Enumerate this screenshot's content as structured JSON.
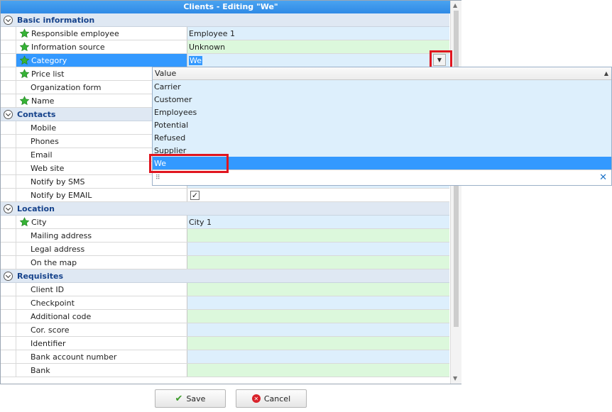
{
  "window": {
    "title": "Clients - Editing \"We\""
  },
  "sections": [
    {
      "title": "Basic information",
      "rows": [
        {
          "label": "Responsible employee",
          "value": "Employee 1",
          "required": true,
          "tone": "blue"
        },
        {
          "label": "Information source",
          "value": "Unknown",
          "required": true,
          "tone": "green"
        },
        {
          "label": "Category",
          "value": "We",
          "required": true,
          "tone": "blue",
          "selected": true
        },
        {
          "label": "Price list",
          "value": "",
          "required": true,
          "tone": "green"
        },
        {
          "label": "Organization form",
          "value": "",
          "required": false,
          "tone": "blue"
        },
        {
          "label": "Name",
          "value": "",
          "required": true,
          "tone": "green"
        }
      ]
    },
    {
      "title": "Contacts",
      "rows": [
        {
          "label": "Mobile",
          "value": "",
          "required": false,
          "tone": "blue"
        },
        {
          "label": "Phones",
          "value": "",
          "required": false,
          "tone": "green"
        },
        {
          "label": "Email",
          "value": "",
          "required": false,
          "tone": "blue"
        },
        {
          "label": "Web site",
          "value": "",
          "required": false,
          "tone": "green"
        },
        {
          "label": "Notify by SMS",
          "value": "",
          "required": false,
          "tone": "blue"
        },
        {
          "label": "Notify by EMAIL",
          "value": "",
          "required": false,
          "tone": "none",
          "checkbox": true,
          "checked": true
        }
      ]
    },
    {
      "title": "Location",
      "rows": [
        {
          "label": "City",
          "value": "City 1",
          "required": true,
          "tone": "blue"
        },
        {
          "label": "Mailing address",
          "value": "",
          "required": false,
          "tone": "green"
        },
        {
          "label": "Legal address",
          "value": "",
          "required": false,
          "tone": "blue"
        },
        {
          "label": "On the map",
          "value": "",
          "required": false,
          "tone": "green"
        }
      ]
    },
    {
      "title": "Requisites",
      "rows": [
        {
          "label": "Client ID",
          "value": "",
          "required": false,
          "tone": "green"
        },
        {
          "label": "Checkpoint",
          "value": "",
          "required": false,
          "tone": "blue"
        },
        {
          "label": "Additional code",
          "value": "",
          "required": false,
          "tone": "green"
        },
        {
          "label": "Cor. score",
          "value": "",
          "required": false,
          "tone": "blue"
        },
        {
          "label": "Identifier",
          "value": "",
          "required": false,
          "tone": "green"
        },
        {
          "label": "Bank account number",
          "value": "",
          "required": false,
          "tone": "blue"
        },
        {
          "label": "Bank",
          "value": "",
          "required": false,
          "tone": "green"
        }
      ]
    }
  ],
  "dropdown": {
    "header": "Value",
    "items": [
      "Carrier",
      "Customer",
      "Employees",
      "Potential",
      "Refused",
      "Supplier",
      "We"
    ],
    "selected": "We"
  },
  "buttons": {
    "save": "Save",
    "cancel": "Cancel"
  },
  "colors": {
    "accent": "#3399ff",
    "title_bar": "#2f8ae6",
    "highlight": "#e0151f",
    "required_star": "#36b336"
  },
  "icons": {
    "required": "green-star-icon",
    "section": "collapse-circle-icon",
    "save": "checkmark-icon",
    "cancel": "cancel-circle-icon"
  }
}
